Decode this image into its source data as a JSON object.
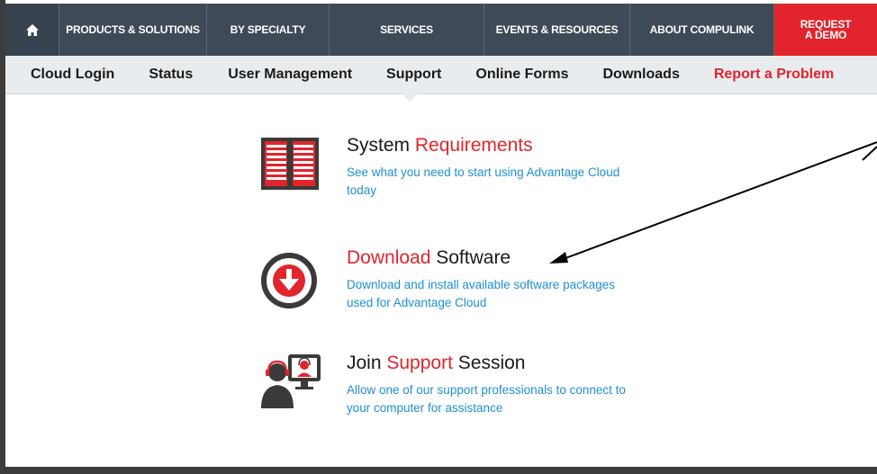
{
  "top_nav": {
    "home_icon": "home-icon",
    "items": [
      "PRODUCTS & SOLUTIONS",
      "BY SPECIALTY",
      "SERVICES",
      "EVENTS & RESOURCES",
      "ABOUT COMPULINK"
    ],
    "demo_line1": "REQUEST",
    "demo_line2": "A DEMO",
    "colors": {
      "bar": "#3f4a56",
      "demo": "#e2242c"
    }
  },
  "sub_nav": {
    "items": [
      "Cloud Login",
      "Status",
      "User Management",
      "Support",
      "Online Forms",
      "Downloads",
      "Report a Problem"
    ],
    "active": "Support",
    "highlight_color": "#e2242c"
  },
  "entries": [
    {
      "icon": "document-icon",
      "title_pre": "System ",
      "title_hl": "Requirements",
      "title_post": "",
      "desc": "See what you need to start using Advantage Cloud today"
    },
    {
      "icon": "download-circle-icon",
      "title_pre": "",
      "title_hl": "Download",
      "title_post": " Software",
      "desc": "Download and install available software packages used for Advantage Cloud"
    },
    {
      "icon": "support-session-icon",
      "title_pre": "Join ",
      "title_hl": "Support",
      "title_post": " Session",
      "desc": "Allow one of our support professionals to connect to your computer for assistance"
    }
  ],
  "annotation": {
    "icon": "annotation-arrow-icon",
    "color": "#000000"
  }
}
